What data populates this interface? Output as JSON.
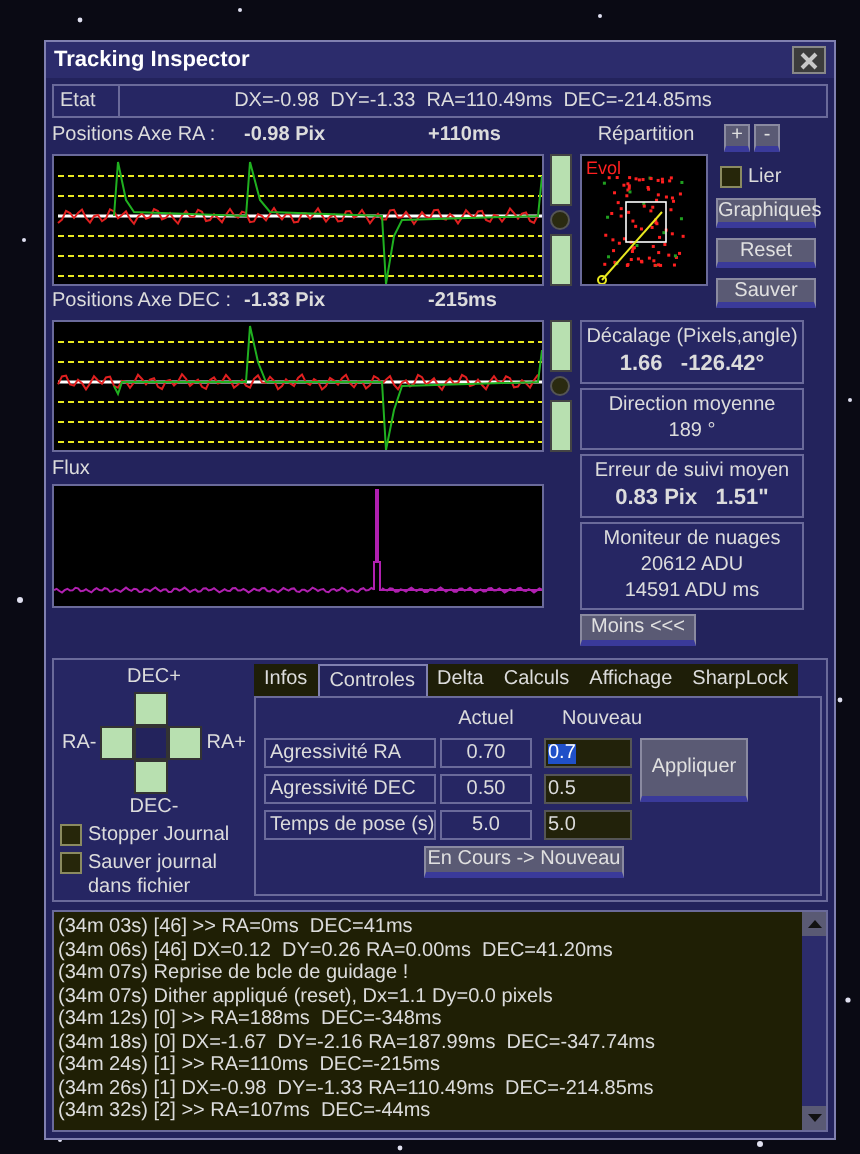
{
  "window": {
    "title": "Tracking Inspector"
  },
  "status": {
    "label": "Etat",
    "value": "DX=-0.98  DY=-1.33  RA=110.49ms  DEC=-214.85ms"
  },
  "ra": {
    "label": "Positions Axe RA :",
    "pix": "-0.98 Pix",
    "ms": "+110ms"
  },
  "repartition": {
    "title": "Répartition",
    "legend": "Evol",
    "zoom_buttons": [
      "+",
      "-"
    ]
  },
  "lier": {
    "label": "Lier",
    "checked": false
  },
  "side_buttons": [
    "Graphiques",
    "Reset",
    "Sauver"
  ],
  "dec": {
    "label": "Positions Axe DEC :",
    "pix": "-1.33 Pix",
    "ms": "-215ms"
  },
  "flux": {
    "label": "Flux"
  },
  "stats": [
    {
      "title": "Décalage (Pixels,angle)",
      "lines": [
        "1.66   -126.42°"
      ],
      "bold": true
    },
    {
      "title": "Direction moyenne",
      "lines": [
        "189 °"
      ],
      "bold": false
    },
    {
      "title": "Erreur de suivi moyen",
      "lines": [
        "0.83 Pix   1.51\""
      ],
      "bold": true
    },
    {
      "title": "Moniteur de nuages",
      "lines": [
        "20612 ADU",
        "14591 ADU ms"
      ],
      "bold": false
    }
  ],
  "moins_button": "Moins <<<",
  "pad": {
    "up": "DEC+",
    "left": "RA-",
    "right": "RA+",
    "down": "DEC-"
  },
  "checkboxes": [
    {
      "label": "Stopper Journal",
      "checked": false
    },
    {
      "label": "Sauver journal dans fichier",
      "checked": false
    }
  ],
  "tabs": [
    {
      "label": "Infos",
      "selected": false
    },
    {
      "label": "Controles",
      "selected": true
    },
    {
      "label": "Delta",
      "selected": false
    },
    {
      "label": "Calculs",
      "selected": false
    },
    {
      "label": "Affichage",
      "selected": false
    },
    {
      "label": "SharpLock",
      "selected": false
    }
  ],
  "controls": {
    "columns": [
      "Actuel",
      "Nouveau"
    ],
    "rows": [
      {
        "label": "Agressivité RA",
        "current": "0.70",
        "new": "0.7",
        "text_selected": true
      },
      {
        "label": "Agressivité DEC",
        "current": "0.50",
        "new": "0.5",
        "text_selected": false
      },
      {
        "label": "Temps de pose (s)",
        "current": "5.0",
        "new": "5.0",
        "text_selected": false
      }
    ],
    "apply_button": "Appliquer",
    "copy_button": "En Cours -> Nouveau"
  },
  "log": [
    "(34m 03s) [46] >> RA=0ms  DEC=41ms",
    "(34m 06s) [46] DX=0.12  DY=0.26 RA=0.00ms  DEC=41.20ms",
    "(34m 07s) Reprise de bcle de guidage !",
    "(34m 07s) Dither appliqué (reset), Dx=1.1 Dy=0.0 pixels",
    "(34m 12s) [0] >> RA=188ms  DEC=-348ms",
    "(34m 18s) [0] DX=-1.67  DY=-2.16 RA=187.99ms  DEC=-347.74ms",
    "(34m 24s) [1] >> RA=110ms  DEC=-215ms",
    "(34m 26s) [1] DX=-0.98  DY=-1.33 RA=110.49ms  DEC=-214.85ms",
    "(34m 32s) [2] >> RA=107ms  DEC=-44ms"
  ]
}
